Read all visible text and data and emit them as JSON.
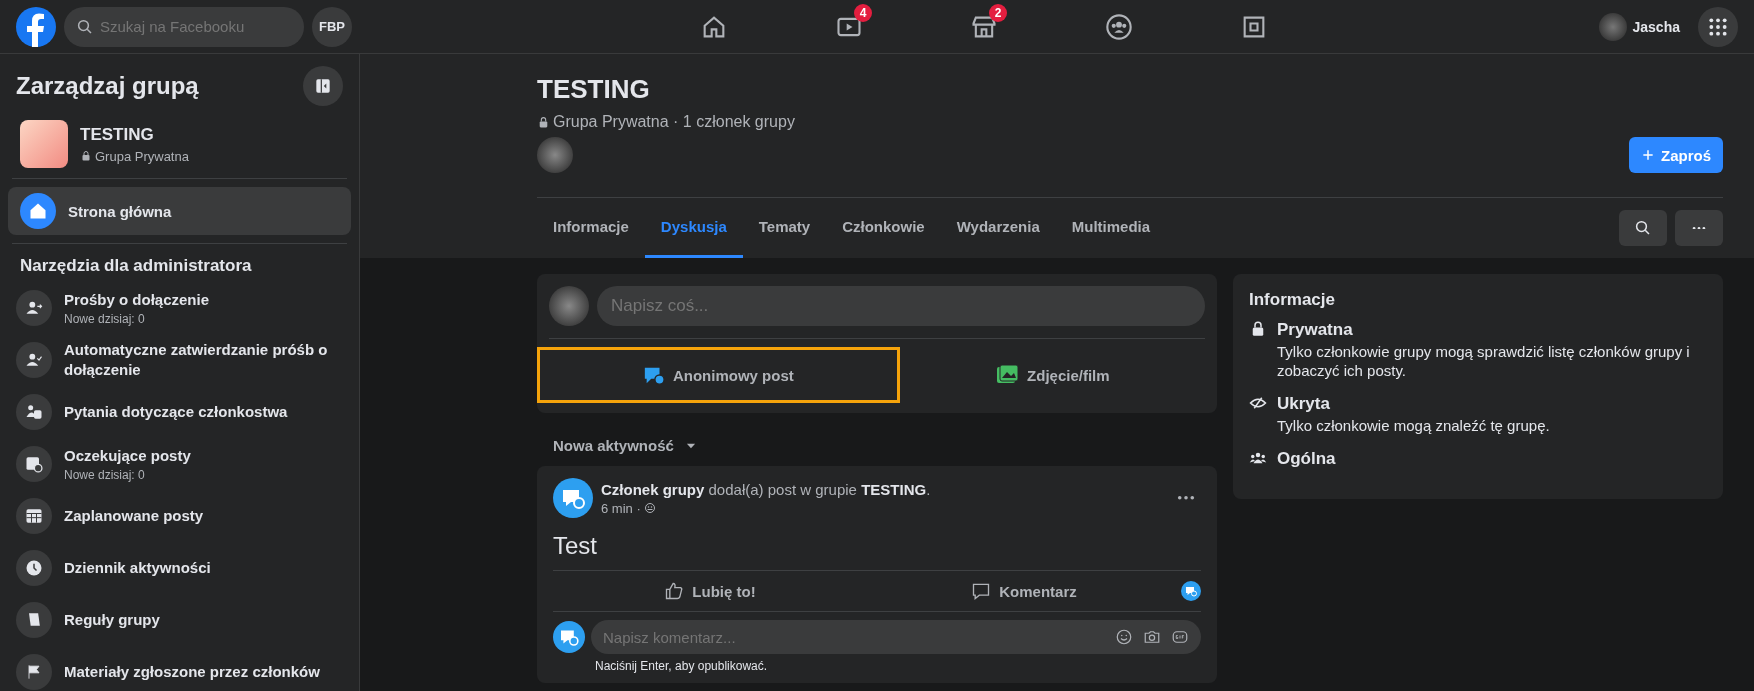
{
  "topbar": {
    "search": {
      "placeholder": "Szukaj na Facebooku"
    },
    "shortcut": "FBP",
    "nav": [
      {
        "kind": "home"
      },
      {
        "kind": "video",
        "badge": "4"
      },
      {
        "kind": "market",
        "badge": "2"
      },
      {
        "kind": "groups"
      },
      {
        "kind": "gaming"
      }
    ],
    "user": "Jascha"
  },
  "sidebar": {
    "title": "Zarządzaj grupą",
    "group": {
      "name": "TESTING",
      "privacy": "Grupa Prywatna"
    },
    "home": {
      "label": "Strona główna",
      "selected": true
    },
    "section": "Narzędzia dla administratora",
    "items": [
      {
        "kind": "join",
        "label": "Prośby o dołączenie",
        "sub": "Nowe dzisiaj: 0"
      },
      {
        "kind": "auto",
        "label": "Automatyczne zatwierdzanie próśb o dołączenie"
      },
      {
        "kind": "questions",
        "label": "Pytania dotyczące członkostwa"
      },
      {
        "kind": "pending",
        "label": "Oczekujące posty",
        "sub": "Nowe dzisiaj: 0"
      },
      {
        "kind": "scheduled",
        "label": "Zaplanowane posty"
      },
      {
        "kind": "log",
        "label": "Dziennik aktywności"
      },
      {
        "kind": "rules",
        "label": "Reguły grupy"
      },
      {
        "kind": "reported",
        "label": "Materiały zgłoszone przez członków"
      }
    ]
  },
  "header": {
    "title": "TESTING",
    "meta": "Grupa Prywatna · 1 członek grupy",
    "invite": "Zaproś",
    "tabs": [
      {
        "label": "Informacje",
        "selected": false
      },
      {
        "label": "Dyskusja",
        "selected": true
      },
      {
        "label": "Tematy",
        "selected": false
      },
      {
        "label": "Członkowie",
        "selected": false
      },
      {
        "label": "Wydarzenia",
        "selected": false
      },
      {
        "label": "Multimedia",
        "selected": false
      }
    ]
  },
  "composer": {
    "placeholder": "Napisz coś...",
    "actions": [
      {
        "kind": "anon",
        "label": "Anonimowy post",
        "highlighted": true
      },
      {
        "kind": "photo",
        "label": "Zdjęcie/film",
        "highlighted": false
      }
    ]
  },
  "sort": "Nowa aktywność",
  "post": {
    "headline": "**Członek grupy** dodał(a) post w grupie **TESTING**.",
    "time": "6 min ·",
    "body": "Test",
    "like": "Lubię to!",
    "comment": "Komentarz",
    "comment_placeholder": "Napisz komentarz...",
    "hint": "Naciśnij Enter, aby opublikować."
  },
  "info": {
    "title": "Informacje",
    "items": [
      {
        "kind": "lock",
        "title": "Prywatna",
        "text": "Tylko członkowie grupy mogą sprawdzić listę członków grupy i zobaczyć ich posty."
      },
      {
        "kind": "hidden",
        "title": "Ukryta",
        "text": "Tylko członkowie mogą znaleźć tę grupę."
      },
      {
        "kind": "people",
        "title": "Ogólna"
      }
    ]
  }
}
